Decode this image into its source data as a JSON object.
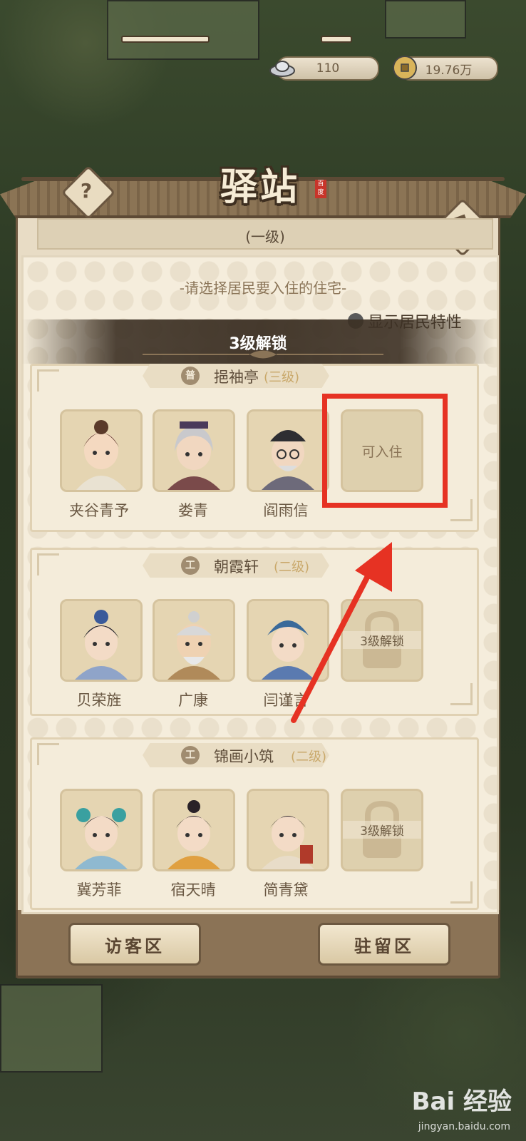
{
  "resources": {
    "silver": "110",
    "coins": "19.76万"
  },
  "header": {
    "title": "驿站",
    "seal": "百度",
    "level": "(一级)",
    "help": "?"
  },
  "prompt": "-请选择居民要入住的住宅-",
  "toggle_label": "显示居民特性",
  "banner": "3级解锁",
  "houses": [
    {
      "badge": "普",
      "name": "挹袖亭",
      "level": "(三级)",
      "residents": [
        "夹谷青予",
        "娄青",
        "阎雨信"
      ],
      "extra_slot": "可入住"
    },
    {
      "badge": "工",
      "name": "朝霞轩",
      "level": "(二级)",
      "residents": [
        "贝荣旌",
        "广康",
        "闫谨言"
      ],
      "extra_slot": "3级解锁"
    },
    {
      "badge": "工",
      "name": "锦画小筑",
      "level": "(二级)",
      "residents": [
        "冀芳菲",
        "宿天晴",
        "简青黛"
      ],
      "extra_slot": "3级解锁"
    }
  ],
  "buttons": {
    "visitor": "访客区",
    "stay": "驻留区"
  },
  "watermark": {
    "brand": "Bai 经验",
    "url": "jingyan.baidu.com"
  },
  "colors": {
    "highlight": "#e63223",
    "panel": "#f5eddc",
    "accent": "#6f5a42"
  }
}
